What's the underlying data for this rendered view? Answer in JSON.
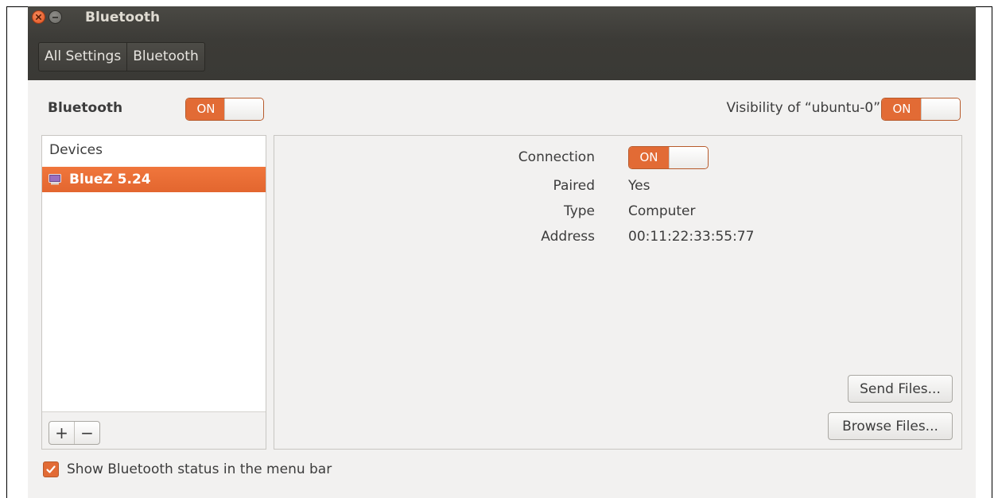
{
  "window": {
    "title": "Bluetooth",
    "breadcrumb": [
      "All Settings",
      "Bluetooth"
    ]
  },
  "bluetooth": {
    "label": "Bluetooth",
    "switch_label": "ON",
    "visibility_label": "Visibility of “ubuntu-0”",
    "visibility_switch_label": "ON"
  },
  "devices": {
    "header": "Devices",
    "items": [
      {
        "name": "BlueZ 5.24",
        "icon": "computer-icon",
        "selected": true
      }
    ],
    "add_label": "+",
    "remove_label": "−"
  },
  "details": {
    "connection_key": "Connection",
    "connection_switch_label": "ON",
    "paired_key": "Paired",
    "paired_value": "Yes",
    "type_key": "Type",
    "type_value": "Computer",
    "address_key": "Address",
    "address_value": "00:11:22:33:55:77",
    "send_files_label": "Send Files...",
    "browse_files_label": "Browse Files..."
  },
  "footer": {
    "show_status_label": "Show Bluetooth status in the menu bar",
    "show_status_checked": true
  },
  "colors": {
    "accent": "#e26b35",
    "titlebar": "#3c3b37",
    "window_bg": "#f2f1f0"
  }
}
